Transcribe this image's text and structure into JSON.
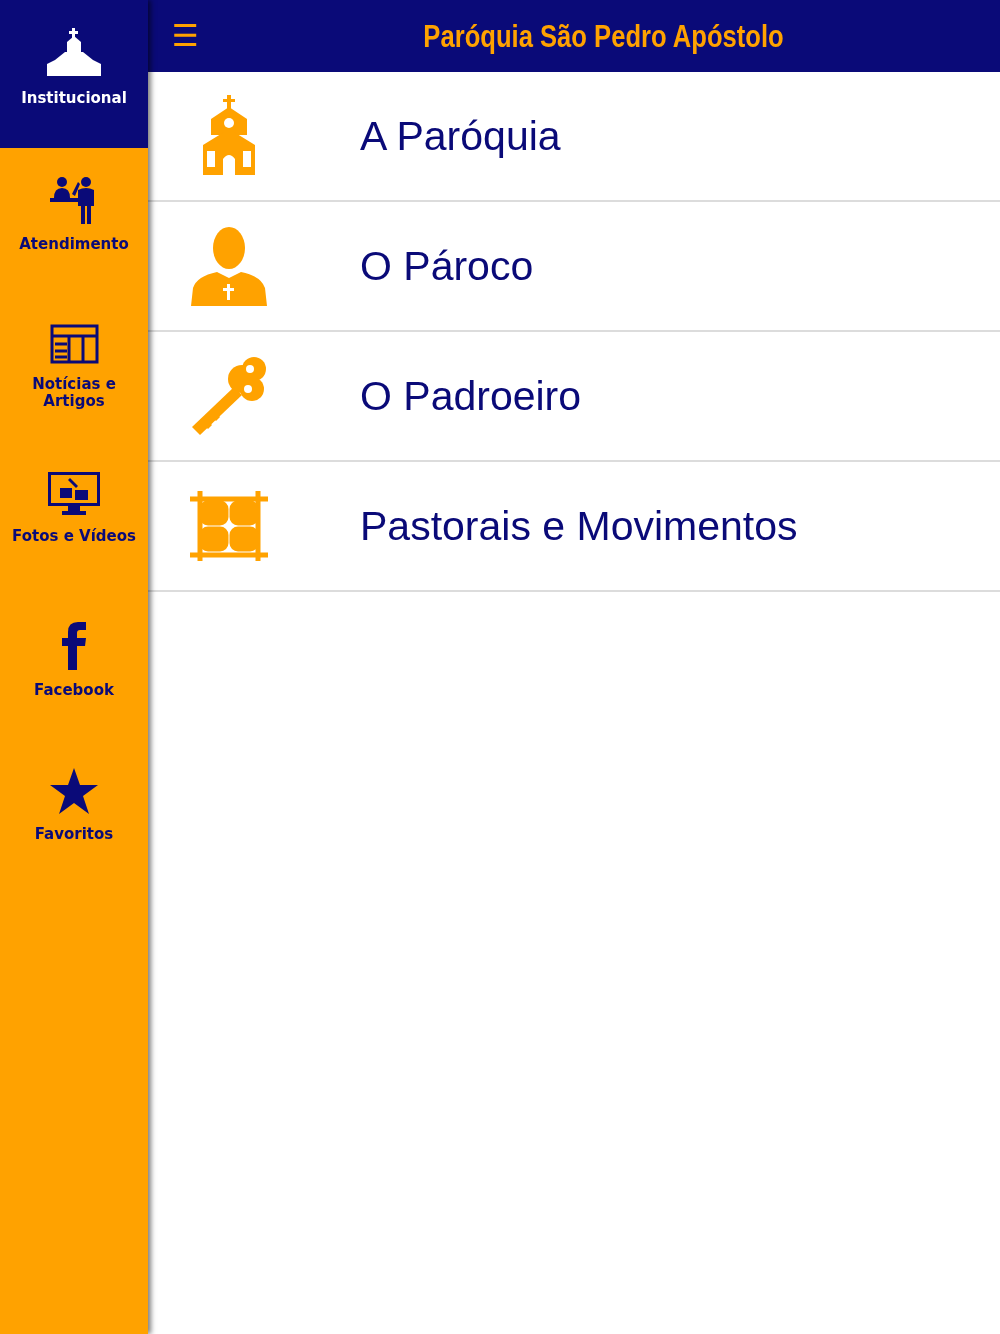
{
  "header": {
    "menu_glyph": "☰",
    "title": "Paróquia São Pedro Apóstolo"
  },
  "sidebar": {
    "items": [
      {
        "label": "Institucional",
        "selected": true
      },
      {
        "label": "Atendimento",
        "selected": false
      },
      {
        "label": "Notícias e Artigos",
        "selected": false
      },
      {
        "label": "Fotos e Vídeos",
        "selected": false
      },
      {
        "label": "Facebook",
        "selected": false
      },
      {
        "label": "Favoritos",
        "selected": false
      }
    ]
  },
  "menu": {
    "items": [
      {
        "label": "A Paróquia"
      },
      {
        "label": "O Pároco"
      },
      {
        "label": "O Padroeiro"
      },
      {
        "label": "Pastorais e Movimentos"
      }
    ]
  }
}
